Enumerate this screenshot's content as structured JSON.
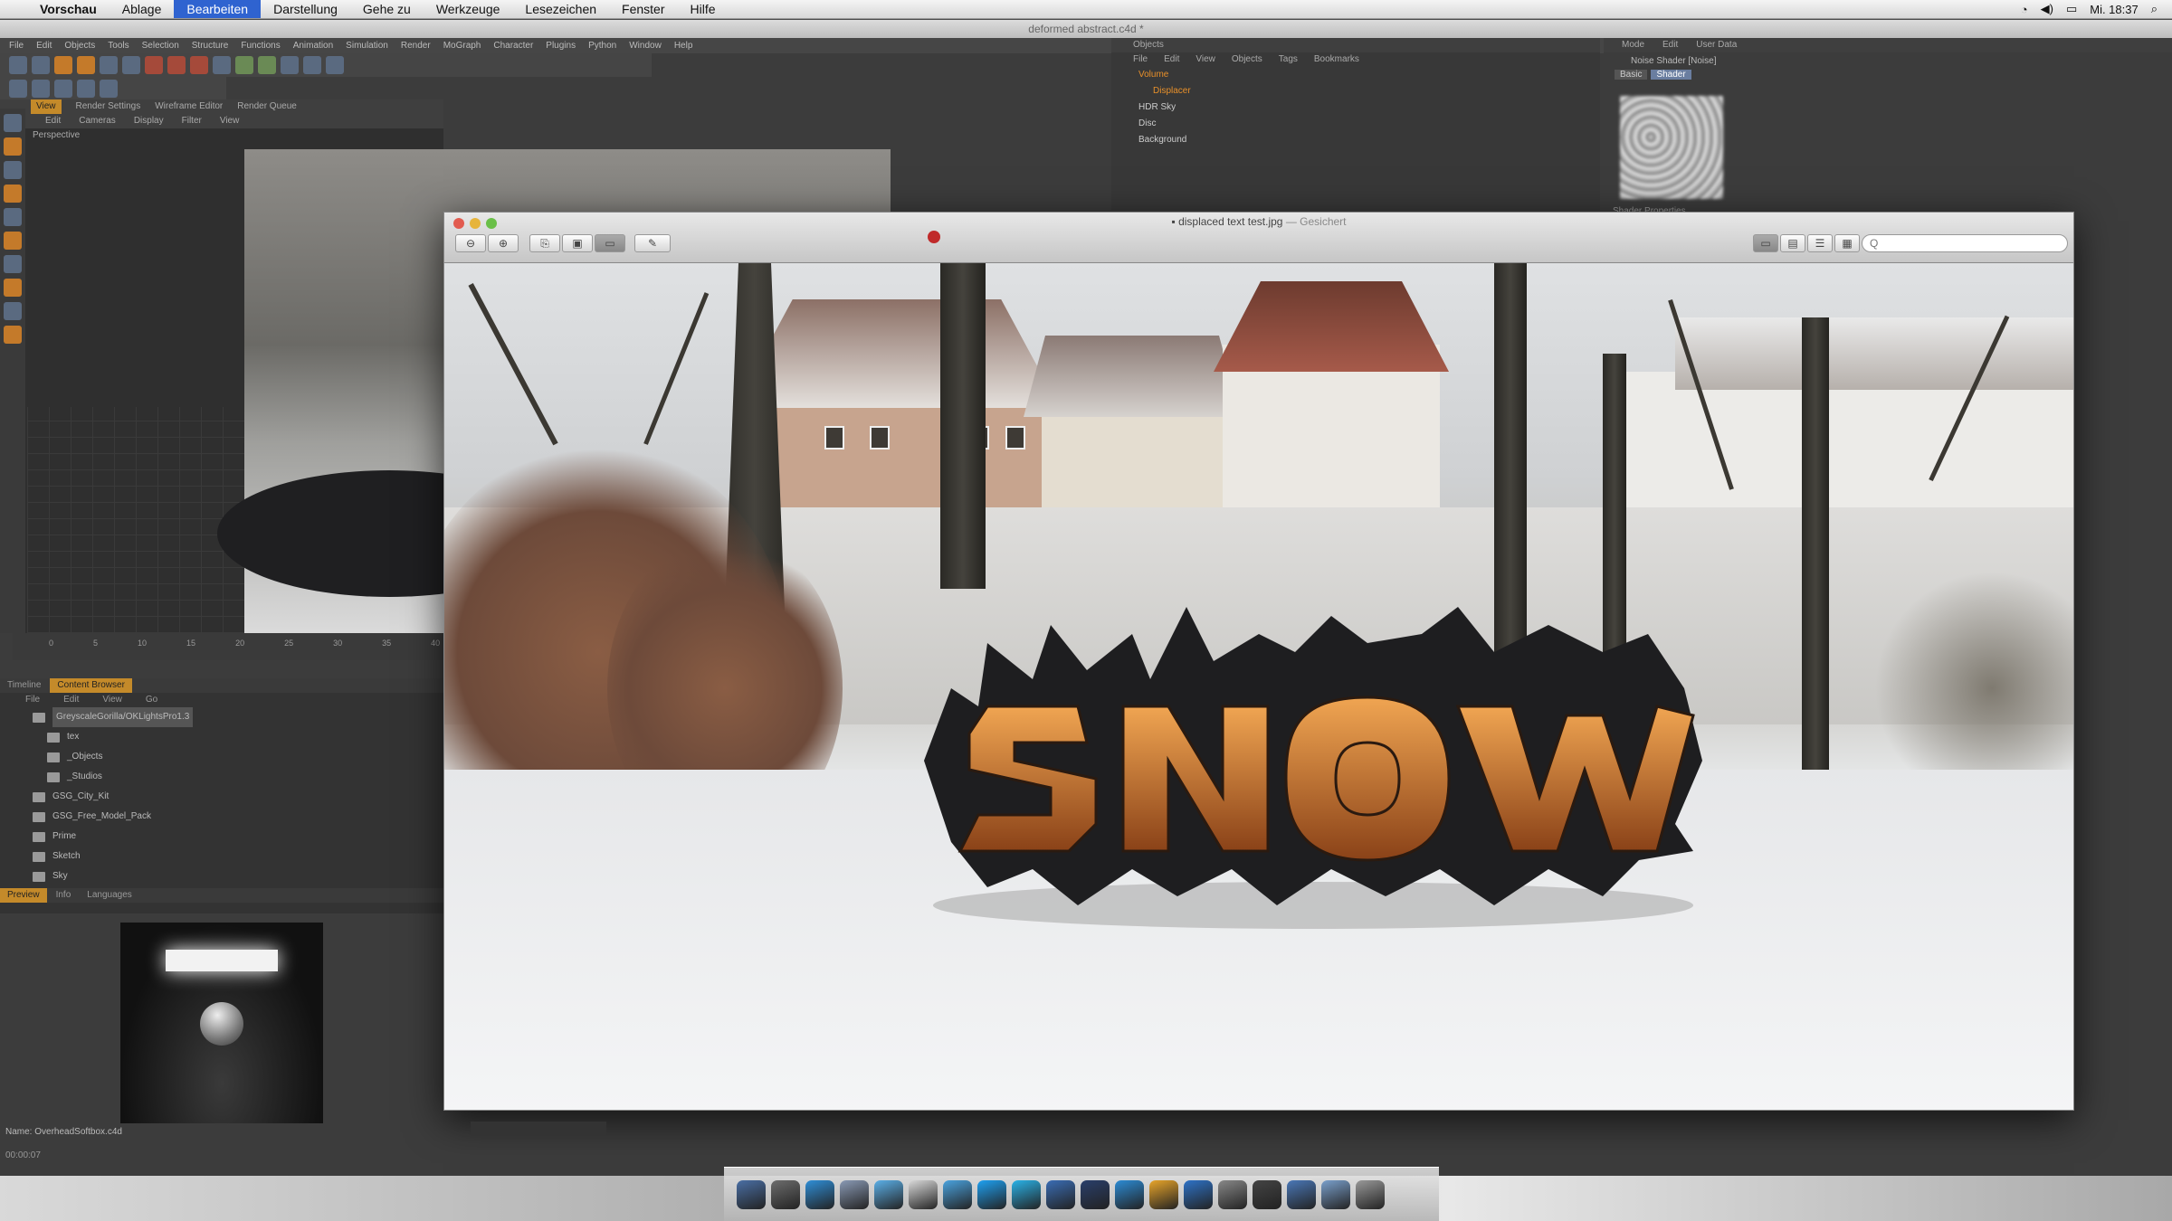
{
  "menubar": {
    "app_name": "Vorschau",
    "items": [
      "Ablage",
      "Bearbeiten",
      "Darstellung",
      "Gehe zu",
      "Werkzeuge",
      "Lesezeichen",
      "Fenster",
      "Hilfe"
    ],
    "selected": "Bearbeiten",
    "clock": "Mi. 18:37"
  },
  "c4d": {
    "window_title": "deformed abstract.c4d *",
    "menu": [
      "File",
      "Edit",
      "Objects",
      "Tools",
      "Selection",
      "Structure",
      "Functions",
      "Animation",
      "Simulation",
      "Render",
      "MoGraph",
      "Character",
      "Plugins",
      "Python",
      "Window",
      "Help"
    ],
    "viewport_tabs": [
      "View",
      "Render Settings",
      "Wireframe Editor",
      "Render Queue"
    ],
    "viewport_menu": [
      "Edit",
      "Cameras",
      "Display",
      "Filter",
      "View"
    ],
    "viewport_label": "Perspective",
    "timeline_ticks": [
      "0",
      "5",
      "10",
      "15",
      "20",
      "25",
      "30",
      "35",
      "40"
    ],
    "browser_tabs": [
      "Timeline",
      "Content Browser"
    ],
    "browser_menu": [
      "File",
      "Edit",
      "View",
      "Go"
    ],
    "browser_items": [
      "GreyscaleGorilla/OKLightsPro1.3",
      "tex",
      "_Objects",
      "_Studios",
      "GSG_City_Kit",
      "GSG_Free_Model_Pack",
      "Prime",
      "Sketch",
      "Sky"
    ],
    "preview_tabs": [
      "Preview",
      "Info",
      "Languages"
    ],
    "file_name": "Name: OverheadSoftbox.c4d",
    "time": "00:00:07"
  },
  "objects": {
    "header": "Objects",
    "menu": [
      "File",
      "Edit",
      "View",
      "Objects",
      "Tags",
      "Bookmarks"
    ],
    "rows": [
      "Volume",
      "Displacer",
      "HDR Sky",
      "Disc",
      "Background"
    ]
  },
  "attributes": {
    "menu": [
      "Mode",
      "Edit",
      "User Data"
    ],
    "title": "Noise Shader [Noise]",
    "tabs": [
      "Basic",
      "Shader"
    ],
    "section": "Shader Properties"
  },
  "preview_window": {
    "title": "displaced text test.jpg",
    "status": "Gesichert",
    "search_placeholder": "Q"
  },
  "dock_colors": [
    "#4a6fa5",
    "#6d6d6d",
    "#2f8fd8",
    "#8a9ab5",
    "#5bb0e8",
    "#d9d9d9",
    "#4aa3df",
    "#1ea1f2",
    "#2ab3e8",
    "#3a6db5",
    "#2a3f6b",
    "#2c8cd5",
    "#e8a52a",
    "#2e73c8",
    "#888",
    "#444",
    "#4a78b8",
    "#7aa0cc",
    "#999"
  ]
}
